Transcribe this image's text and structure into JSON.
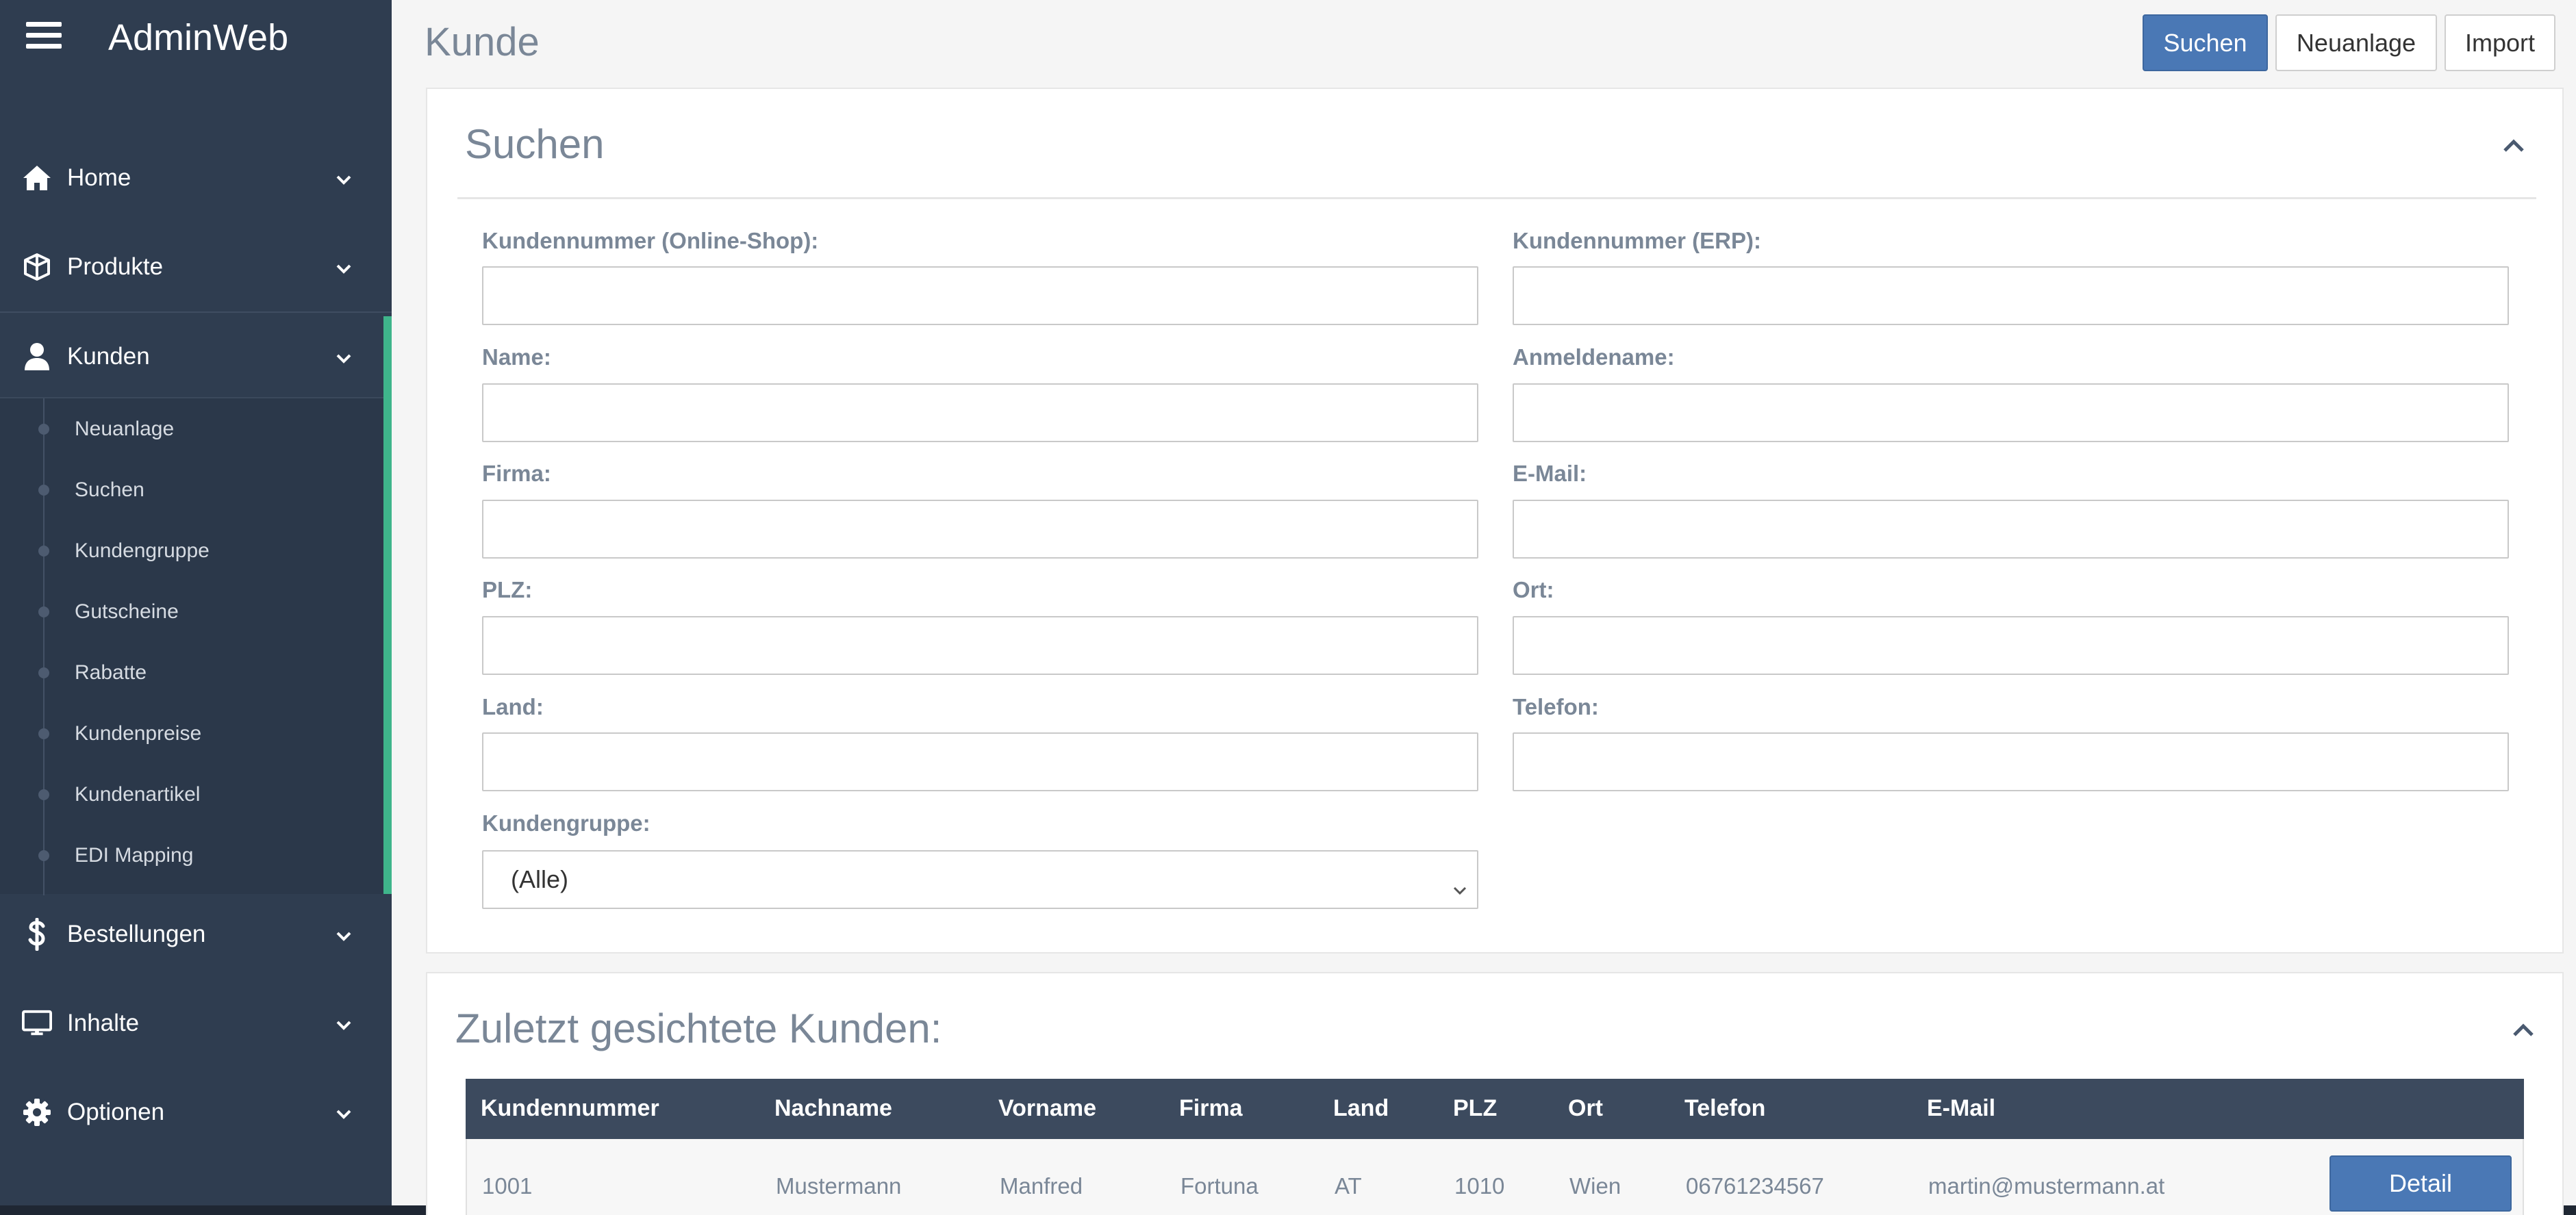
{
  "app": {
    "title": "AdminWeb"
  },
  "sidebar": {
    "items": [
      {
        "label": "Home",
        "icon": "home-icon"
      },
      {
        "label": "Produkte",
        "icon": "cube-icon"
      },
      {
        "label": "Kunden",
        "icon": "user-icon"
      },
      {
        "label": "Bestellungen",
        "icon": "dollar-icon"
      },
      {
        "label": "Inhalte",
        "icon": "monitor-icon"
      },
      {
        "label": "Optionen",
        "icon": "gear-icon"
      }
    ],
    "submenu": [
      {
        "label": "Neuanlage"
      },
      {
        "label": "Suchen"
      },
      {
        "label": "Kundengruppe"
      },
      {
        "label": "Gutscheine"
      },
      {
        "label": "Rabatte"
      },
      {
        "label": "Kundenpreise"
      },
      {
        "label": "Kundenartikel"
      },
      {
        "label": "EDI Mapping"
      }
    ],
    "colors": {
      "background": "#2f3d50",
      "active_bar": "#3fb58b"
    }
  },
  "header": {
    "title": "Kunde",
    "buttons": {
      "search": "Suchen",
      "new": "Neuanlage",
      "import": "Import"
    }
  },
  "search_panel": {
    "title": "Suchen",
    "fields": {
      "kundennummer_shop": {
        "label": "Kundennummer (Online-Shop):",
        "value": ""
      },
      "kundennummer_erp": {
        "label": "Kundennummer (ERP):",
        "value": ""
      },
      "name": {
        "label": "Name:",
        "value": ""
      },
      "anmeldename": {
        "label": "Anmeldename:",
        "value": ""
      },
      "firma": {
        "label": "Firma:",
        "value": ""
      },
      "email": {
        "label": "E-Mail:",
        "value": ""
      },
      "plz": {
        "label": "PLZ:",
        "value": ""
      },
      "ort": {
        "label": "Ort:",
        "value": ""
      },
      "land": {
        "label": "Land:",
        "value": ""
      },
      "telefon": {
        "label": "Telefon:",
        "value": ""
      },
      "kundengruppe": {
        "label": "Kundengruppe:",
        "selected": "(Alle)"
      }
    }
  },
  "recent_panel": {
    "title": "Zuletzt gesichtete Kunden:",
    "columns": [
      "Kundennummer",
      "Nachname",
      "Vorname",
      "Firma",
      "Land",
      "PLZ",
      "Ort",
      "Telefon",
      "E-Mail"
    ],
    "rows": [
      {
        "cells": [
          "1001",
          "Mustermann",
          "Manfred",
          "Fortuna",
          "AT",
          "1010",
          "Wien",
          "06761234567",
          "martin@mustermann.at"
        ],
        "action": "Detail"
      }
    ]
  },
  "colors": {
    "primary": "#4a78b5",
    "table_header": "#3c4a5e",
    "label": "#7a8797"
  }
}
